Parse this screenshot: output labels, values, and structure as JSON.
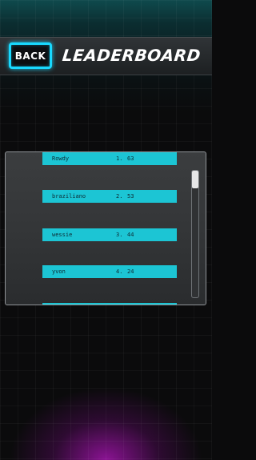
{
  "header": {
    "back_label": "BACK",
    "title": "LEADERBOARD"
  },
  "leaderboard": {
    "rows": [
      {
        "name": "Rowdy",
        "rank": "1.",
        "score": "63"
      },
      {
        "name": "braziliano",
        "rank": "2.",
        "score": "53"
      },
      {
        "name": "wessie",
        "rank": "3.",
        "score": "44"
      },
      {
        "name": "yvon",
        "rank": "4.",
        "score": "24"
      }
    ]
  },
  "colors": {
    "accent": "#18d9ff",
    "row_fill": "#1cc5d4",
    "glow": "#a014aa"
  }
}
